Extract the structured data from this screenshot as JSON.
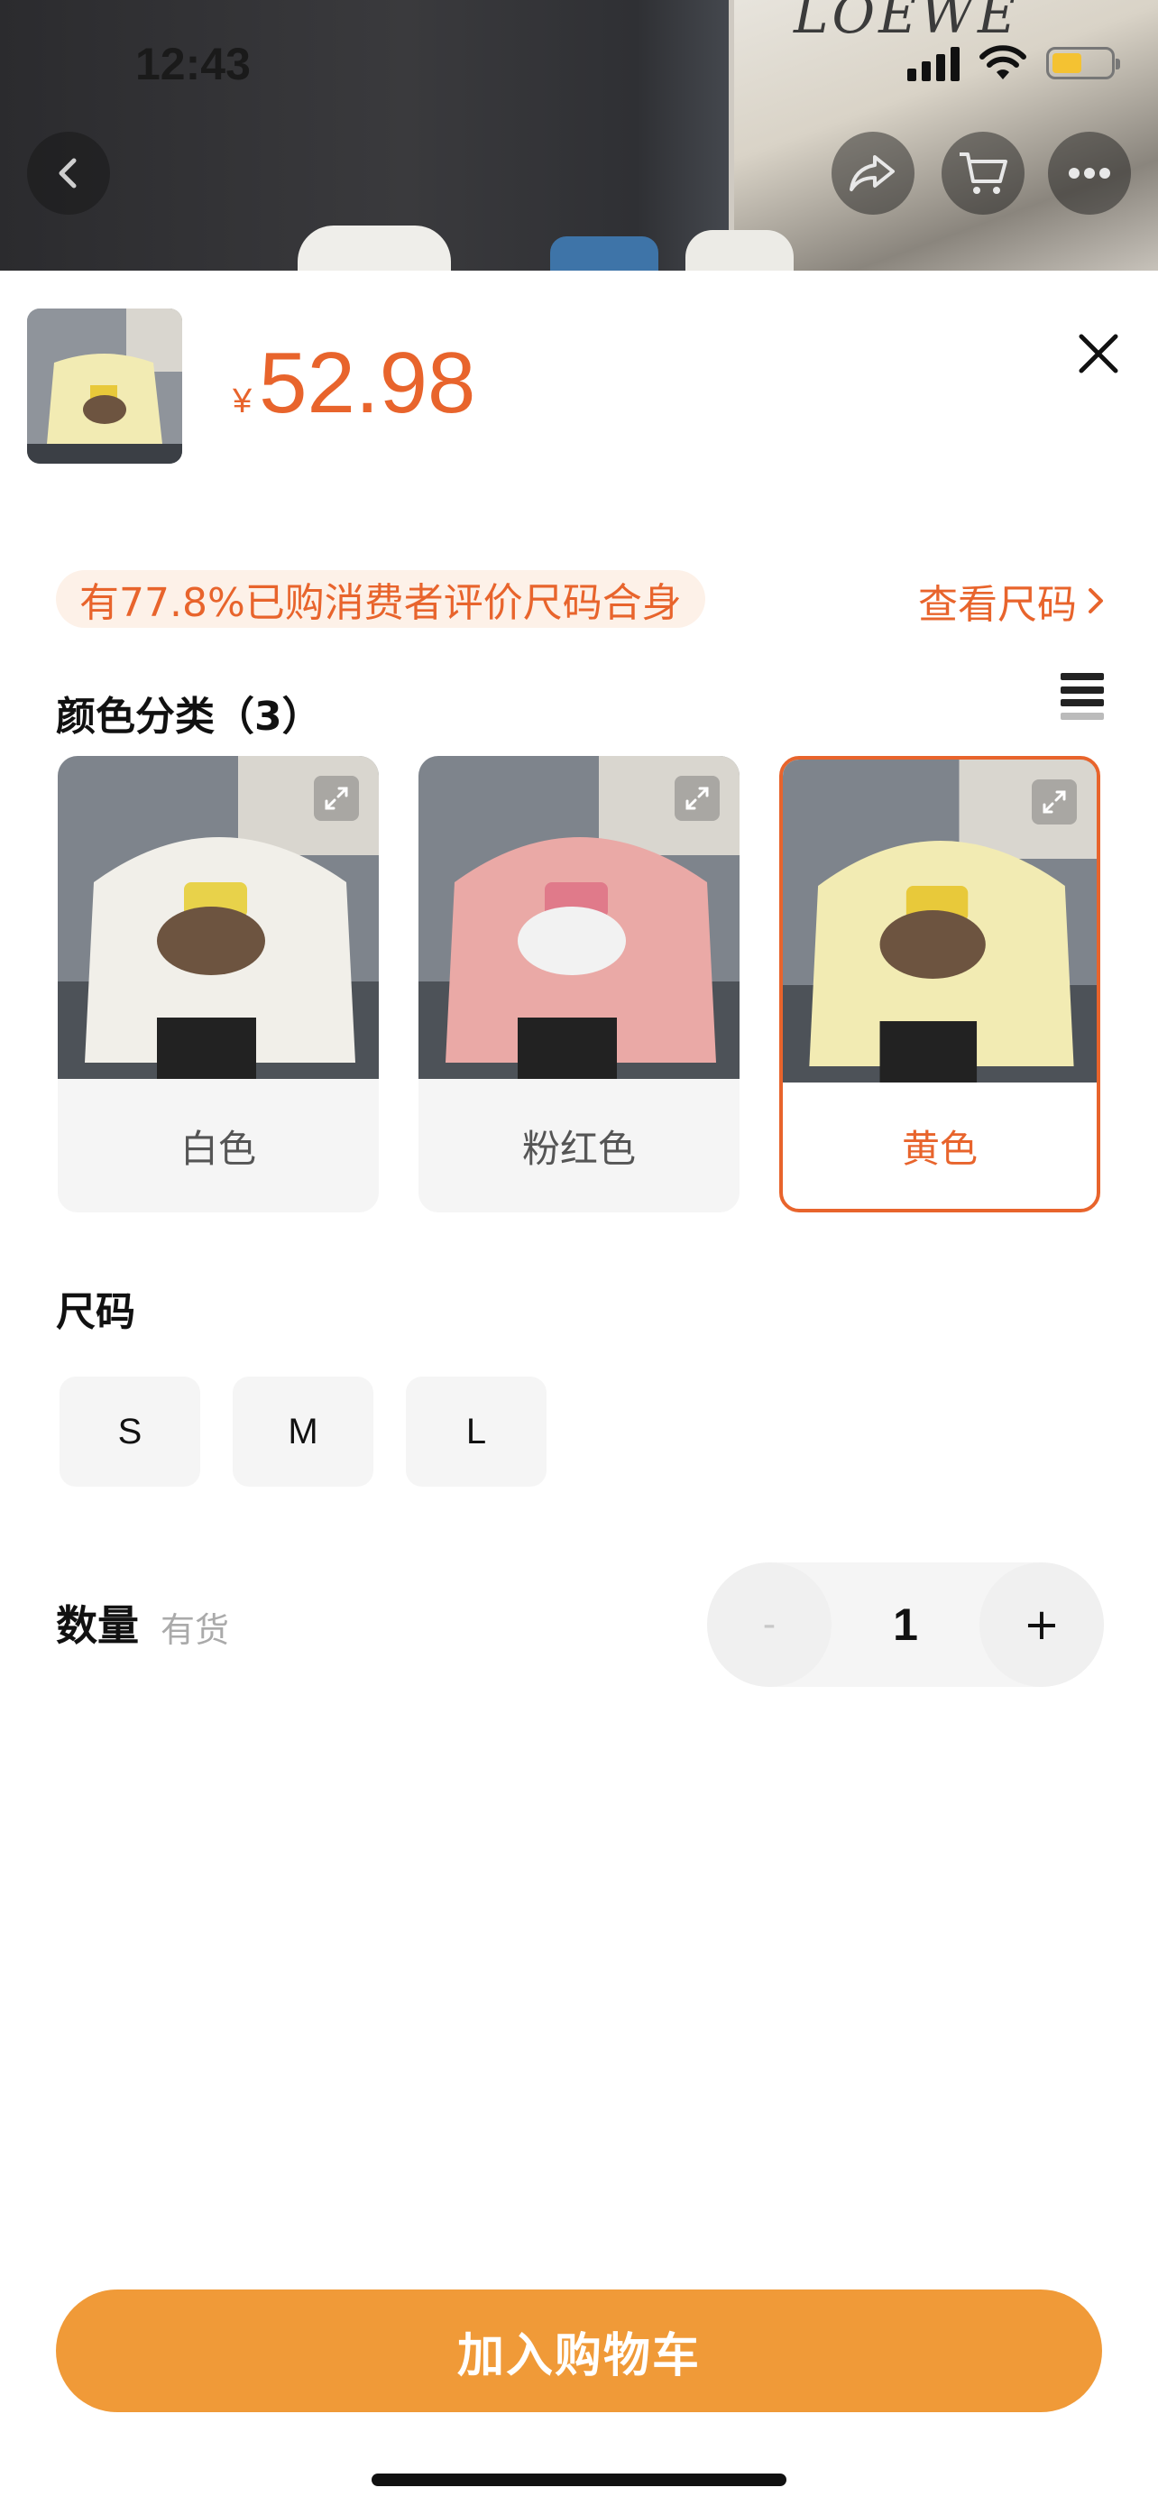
{
  "status_bar": {
    "time": "12:43"
  },
  "header_photo": {
    "poster_text": "LOEWE"
  },
  "nav": {
    "back_icon": "chevron-left-icon",
    "share_icon": "share-icon",
    "cart_icon": "cart-icon",
    "more_icon": "more-dots-icon"
  },
  "product": {
    "currency_symbol": "¥",
    "price": "52.98"
  },
  "fit": {
    "tip": "有77.8%已购消费者评价尺码合身",
    "size_chart_link": "查看尺码"
  },
  "colors": {
    "title": "颜色分类（3）",
    "options": [
      {
        "label": "白色",
        "sweater": "#f1efe9",
        "selected": false
      },
      {
        "label": "粉红色",
        "sweater": "#eaa9a6",
        "selected": false
      },
      {
        "label": "黄色",
        "sweater": "#f2ebb3",
        "selected": true
      }
    ]
  },
  "sizes": {
    "title": "尺码",
    "options": [
      "S",
      "M",
      "L"
    ]
  },
  "quantity": {
    "label": "数量",
    "stock": "有货",
    "minus": "-",
    "value": "1",
    "plus": "+"
  },
  "add_to_cart": "加入购物车",
  "colors_theme": {
    "accent": "#e8642c",
    "button": "#f09a38"
  }
}
